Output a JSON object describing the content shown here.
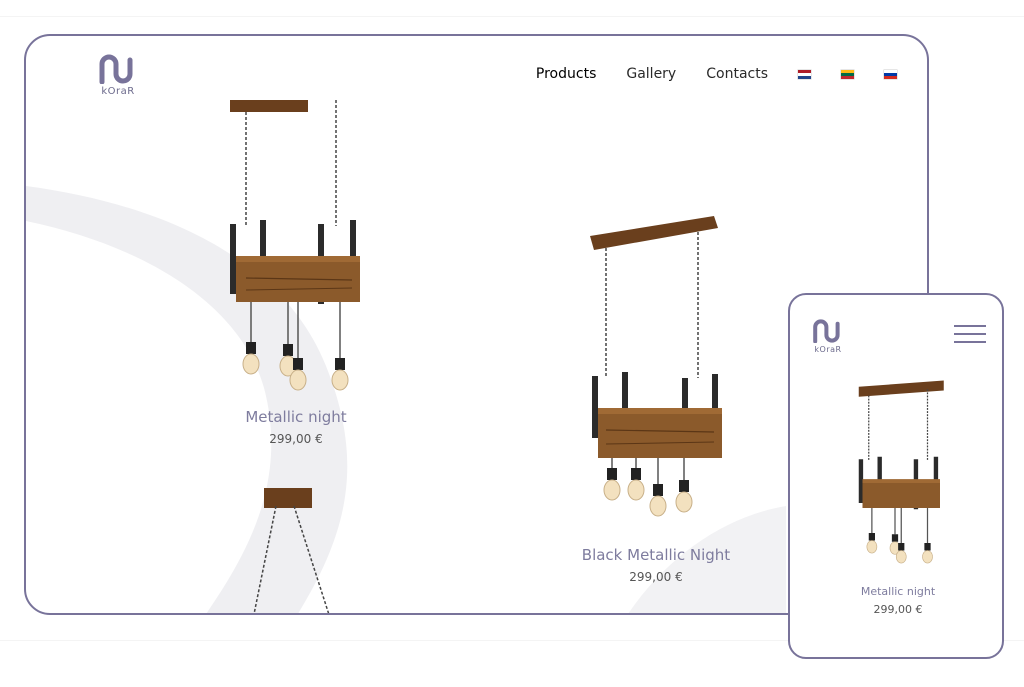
{
  "brand": {
    "logo_text": "kOraR"
  },
  "nav": {
    "items": [
      {
        "label": "Products",
        "active": true
      },
      {
        "label": "Gallery",
        "active": false
      },
      {
        "label": "Contacts",
        "active": false
      }
    ],
    "languages": [
      {
        "name": "Netherlands flag",
        "colors": [
          "#ae1c28",
          "#ffffff",
          "#21468b"
        ]
      },
      {
        "name": "Lithuania flag",
        "colors": [
          "#fdb913",
          "#006a44",
          "#c1272d"
        ]
      },
      {
        "name": "Russia flag",
        "colors": [
          "#ffffff",
          "#0039a6",
          "#d52b1e"
        ]
      }
    ]
  },
  "products": [
    {
      "name": "Metallic night",
      "price": "299,00 €"
    },
    {
      "name": "Black Metallic Night",
      "price": "299,00 €"
    }
  ],
  "mobile": {
    "product": {
      "name": "Metallic night",
      "price": "299,00 €"
    }
  },
  "colors": {
    "frame": "#78739a",
    "product_name": "#7e7c9e",
    "wood": "#7a4a22"
  }
}
